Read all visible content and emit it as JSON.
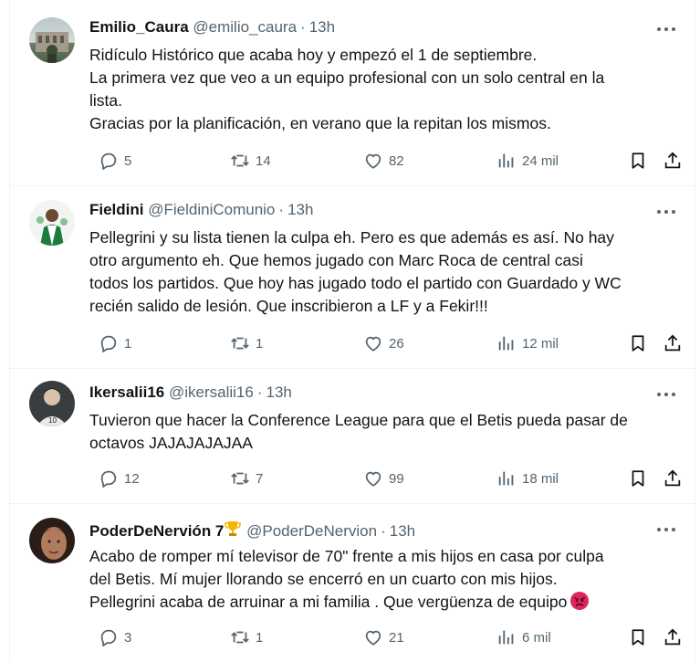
{
  "tweets": [
    {
      "name": "Emilio_Caura",
      "handle": "@emilio_caura",
      "time": "13h",
      "lines": [
        "Ridículo Histórico que acaba hoy y empezó el 1 de septiembre.",
        "La primera vez que veo a un equipo profesional con un solo central en la",
        "lista.",
        "Gracias por la planificación, en verano que la repitan los mismos."
      ],
      "replies": "5",
      "retweets": "14",
      "likes": "82",
      "views": "24 mil"
    },
    {
      "name": "Fieldini",
      "handle": "@FieldiniComunio",
      "time": "13h",
      "lines": [
        "Pellegrini y su lista tienen la culpa eh. Pero es que además es así. No hay",
        "otro argumento eh. Que hemos jugado con Marc Roca de central casi",
        "todos los partidos. Que hoy has jugado todo el partido con Guardado y WC",
        "recién salido de lesión. Que inscribieron a LF y a Fekir!!!"
      ],
      "replies": "1",
      "retweets": "1",
      "likes": "26",
      "views": "12 mil"
    },
    {
      "name": "Ikersalii16",
      "handle": "@ikersalii16",
      "time": "13h",
      "lines": [
        "Tuvieron que hacer la Conference League para que el Betis pueda pasar de",
        "octavos JAJAJAJAJAA"
      ],
      "replies": "12",
      "retweets": "7",
      "likes": "99",
      "views": "18 mil"
    },
    {
      "name": "PoderDeNervión 7",
      "handle": "@PoderDeNervion",
      "time": "13h",
      "lines": [
        "Acabo de romper mí televisor de 70\" frente a mis hijos en casa por culpa",
        "del Betis. Mí mujer llorando se encerró en un cuarto con mis hijos.",
        "Pellegrini acaba de arruinar a mi familia . Que vergüenza de equipo"
      ],
      "replies": "3",
      "retweets": "1",
      "likes": "21",
      "views": "6 mil"
    }
  ],
  "icons": {
    "reply": "reply-icon",
    "retweet": "retweet-icon",
    "like": "heart-icon",
    "views": "views-icon",
    "bookmark": "bookmark-icon",
    "share": "share-icon",
    "more": "more-icon",
    "trophy": "trophy-icon",
    "angry": "angry-face-icon"
  },
  "colors": {
    "text": "#0f1419",
    "muted": "#536471",
    "divider": "#eff3f4",
    "angry": "#e0245e",
    "trophy": "#f4b400"
  }
}
